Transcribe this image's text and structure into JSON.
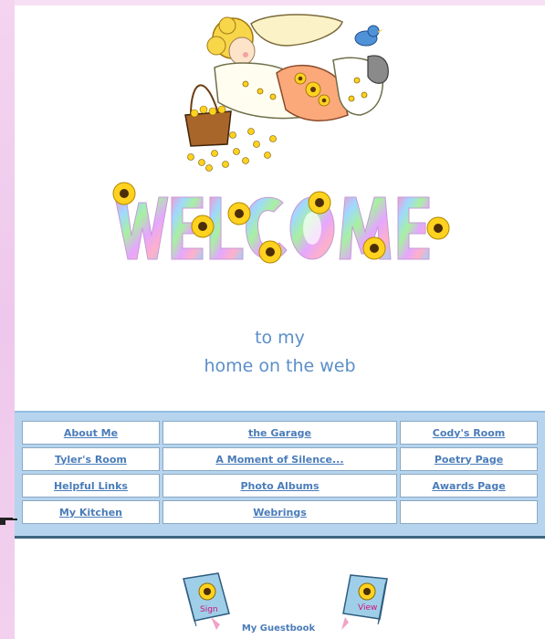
{
  "tagline": {
    "line1": "to my",
    "line2": "home on the web"
  },
  "nav": {
    "rows": [
      [
        "About Me",
        "the Garage",
        "Cody's Room"
      ],
      [
        "Tyler's Room",
        "A Moment of Silence...",
        "Poetry Page"
      ],
      [
        "Helpful Links",
        "Photo Albums",
        "Awards Page"
      ],
      [
        "My Kitchen",
        "Webrings",
        ""
      ]
    ]
  },
  "guestbook": {
    "label": "My Guestbook",
    "sign": "Sign",
    "view": "View"
  },
  "colors": {
    "link": "#4a7cb9",
    "tagline": "#5b8fc9",
    "nav_background": "#b6d4ee",
    "left_border": "#eec8ec",
    "sunflower": "#ffd21f"
  },
  "icons": {
    "angel": "angel-with-basket-icon",
    "bird": "bluebird-icon",
    "welcome": "welcome-banner-graphic",
    "pointer": "pointing-hand-icon",
    "book_sign": "sign-guestbook-icon",
    "book_view": "view-guestbook-icon"
  }
}
